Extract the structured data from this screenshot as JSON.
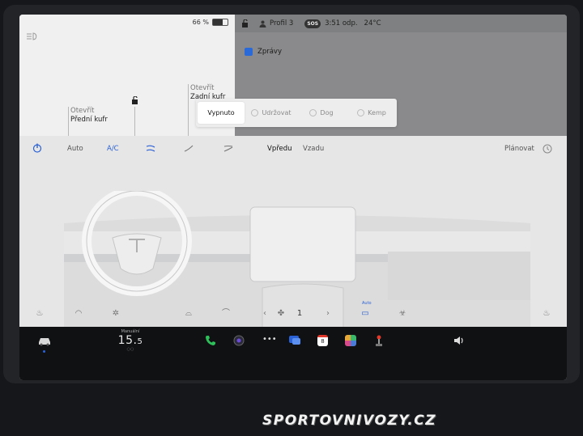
{
  "status": {
    "battery_pct": "66 %",
    "profile": "Profil 3",
    "sos": "SOS",
    "time": "3:51 odp.",
    "outside_temp": "24°C"
  },
  "car": {
    "front_trunk": {
      "action": "Otevřít",
      "name": "Přední kufr"
    },
    "rear_trunk": {
      "action": "Otevřít",
      "name": "Zadní kufr"
    }
  },
  "apps": {
    "messages": "Zprávy"
  },
  "modes": [
    "Vypnuto",
    "Udržovat",
    "Dog",
    "Kemp"
  ],
  "climate": {
    "auto": "Auto",
    "ac": "A/C",
    "front": "Vpředu",
    "rear": "Vzadu",
    "schedule": "Plánovat",
    "fan_level": "1",
    "auto_small": "Auto"
  },
  "dock": {
    "manual_label": "Manuální",
    "temp_int": "15.",
    "temp_dec": "5",
    "notification_count": "8"
  },
  "watermark": "SPORTOVNIVOZY.CZ",
  "colors": {
    "accent": "#2b61d6",
    "dock_bg": "#101113"
  }
}
